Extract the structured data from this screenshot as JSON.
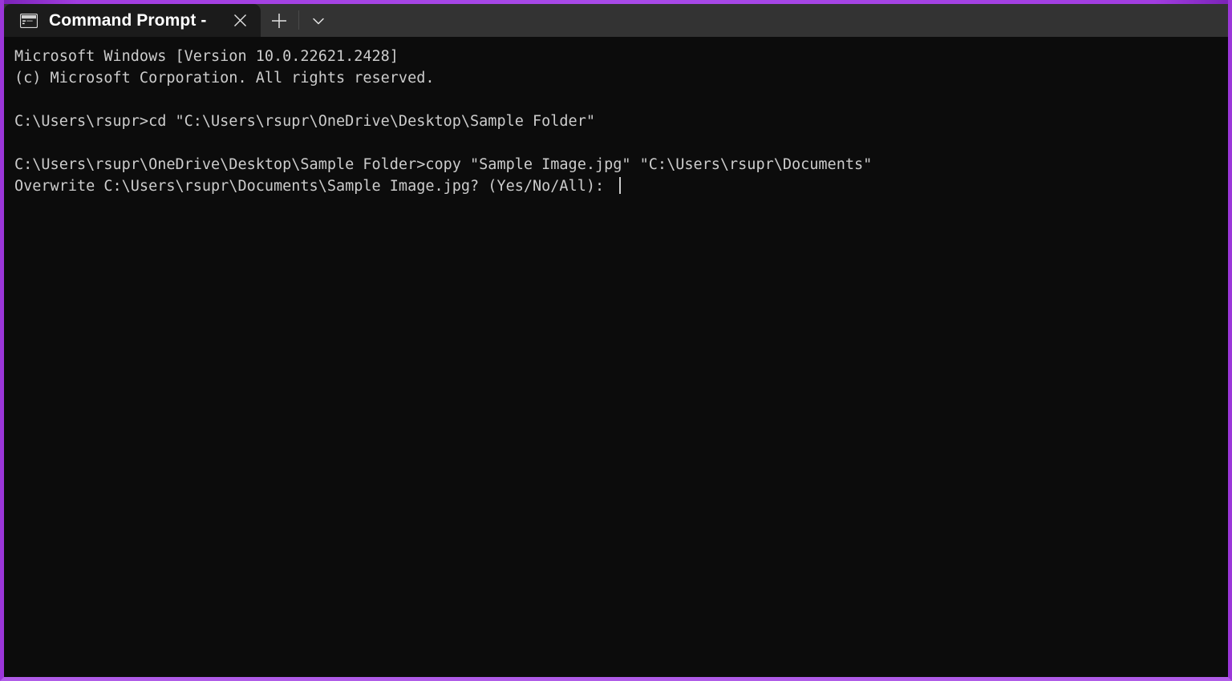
{
  "window": {
    "accent_color": "#a84ae8",
    "titlebar_bg": "#333333",
    "terminal_bg": "#0c0c0c",
    "terminal_fg": "#cccccc"
  },
  "tabstrip": {
    "active_tab": {
      "icon": "command-prompt-icon",
      "title": "Command Prompt -",
      "close_label": "✕"
    },
    "new_tab_label": "+",
    "dropdown_label": "⌄"
  },
  "terminal": {
    "lines": [
      "Microsoft Windows [Version 10.0.22621.2428]",
      "(c) Microsoft Corporation. All rights reserved.",
      "",
      "C:\\Users\\rsupr>cd \"C:\\Users\\rsupr\\OneDrive\\Desktop\\Sample Folder\"",
      "",
      "C:\\Users\\rsupr\\OneDrive\\Desktop\\Sample Folder>copy \"Sample Image.jpg\" \"C:\\Users\\rsupr\\Documents\"",
      "Overwrite C:\\Users\\rsupr\\Documents\\Sample Image.jpg? (Yes/No/All): "
    ],
    "prompt_line_index": 6
  }
}
